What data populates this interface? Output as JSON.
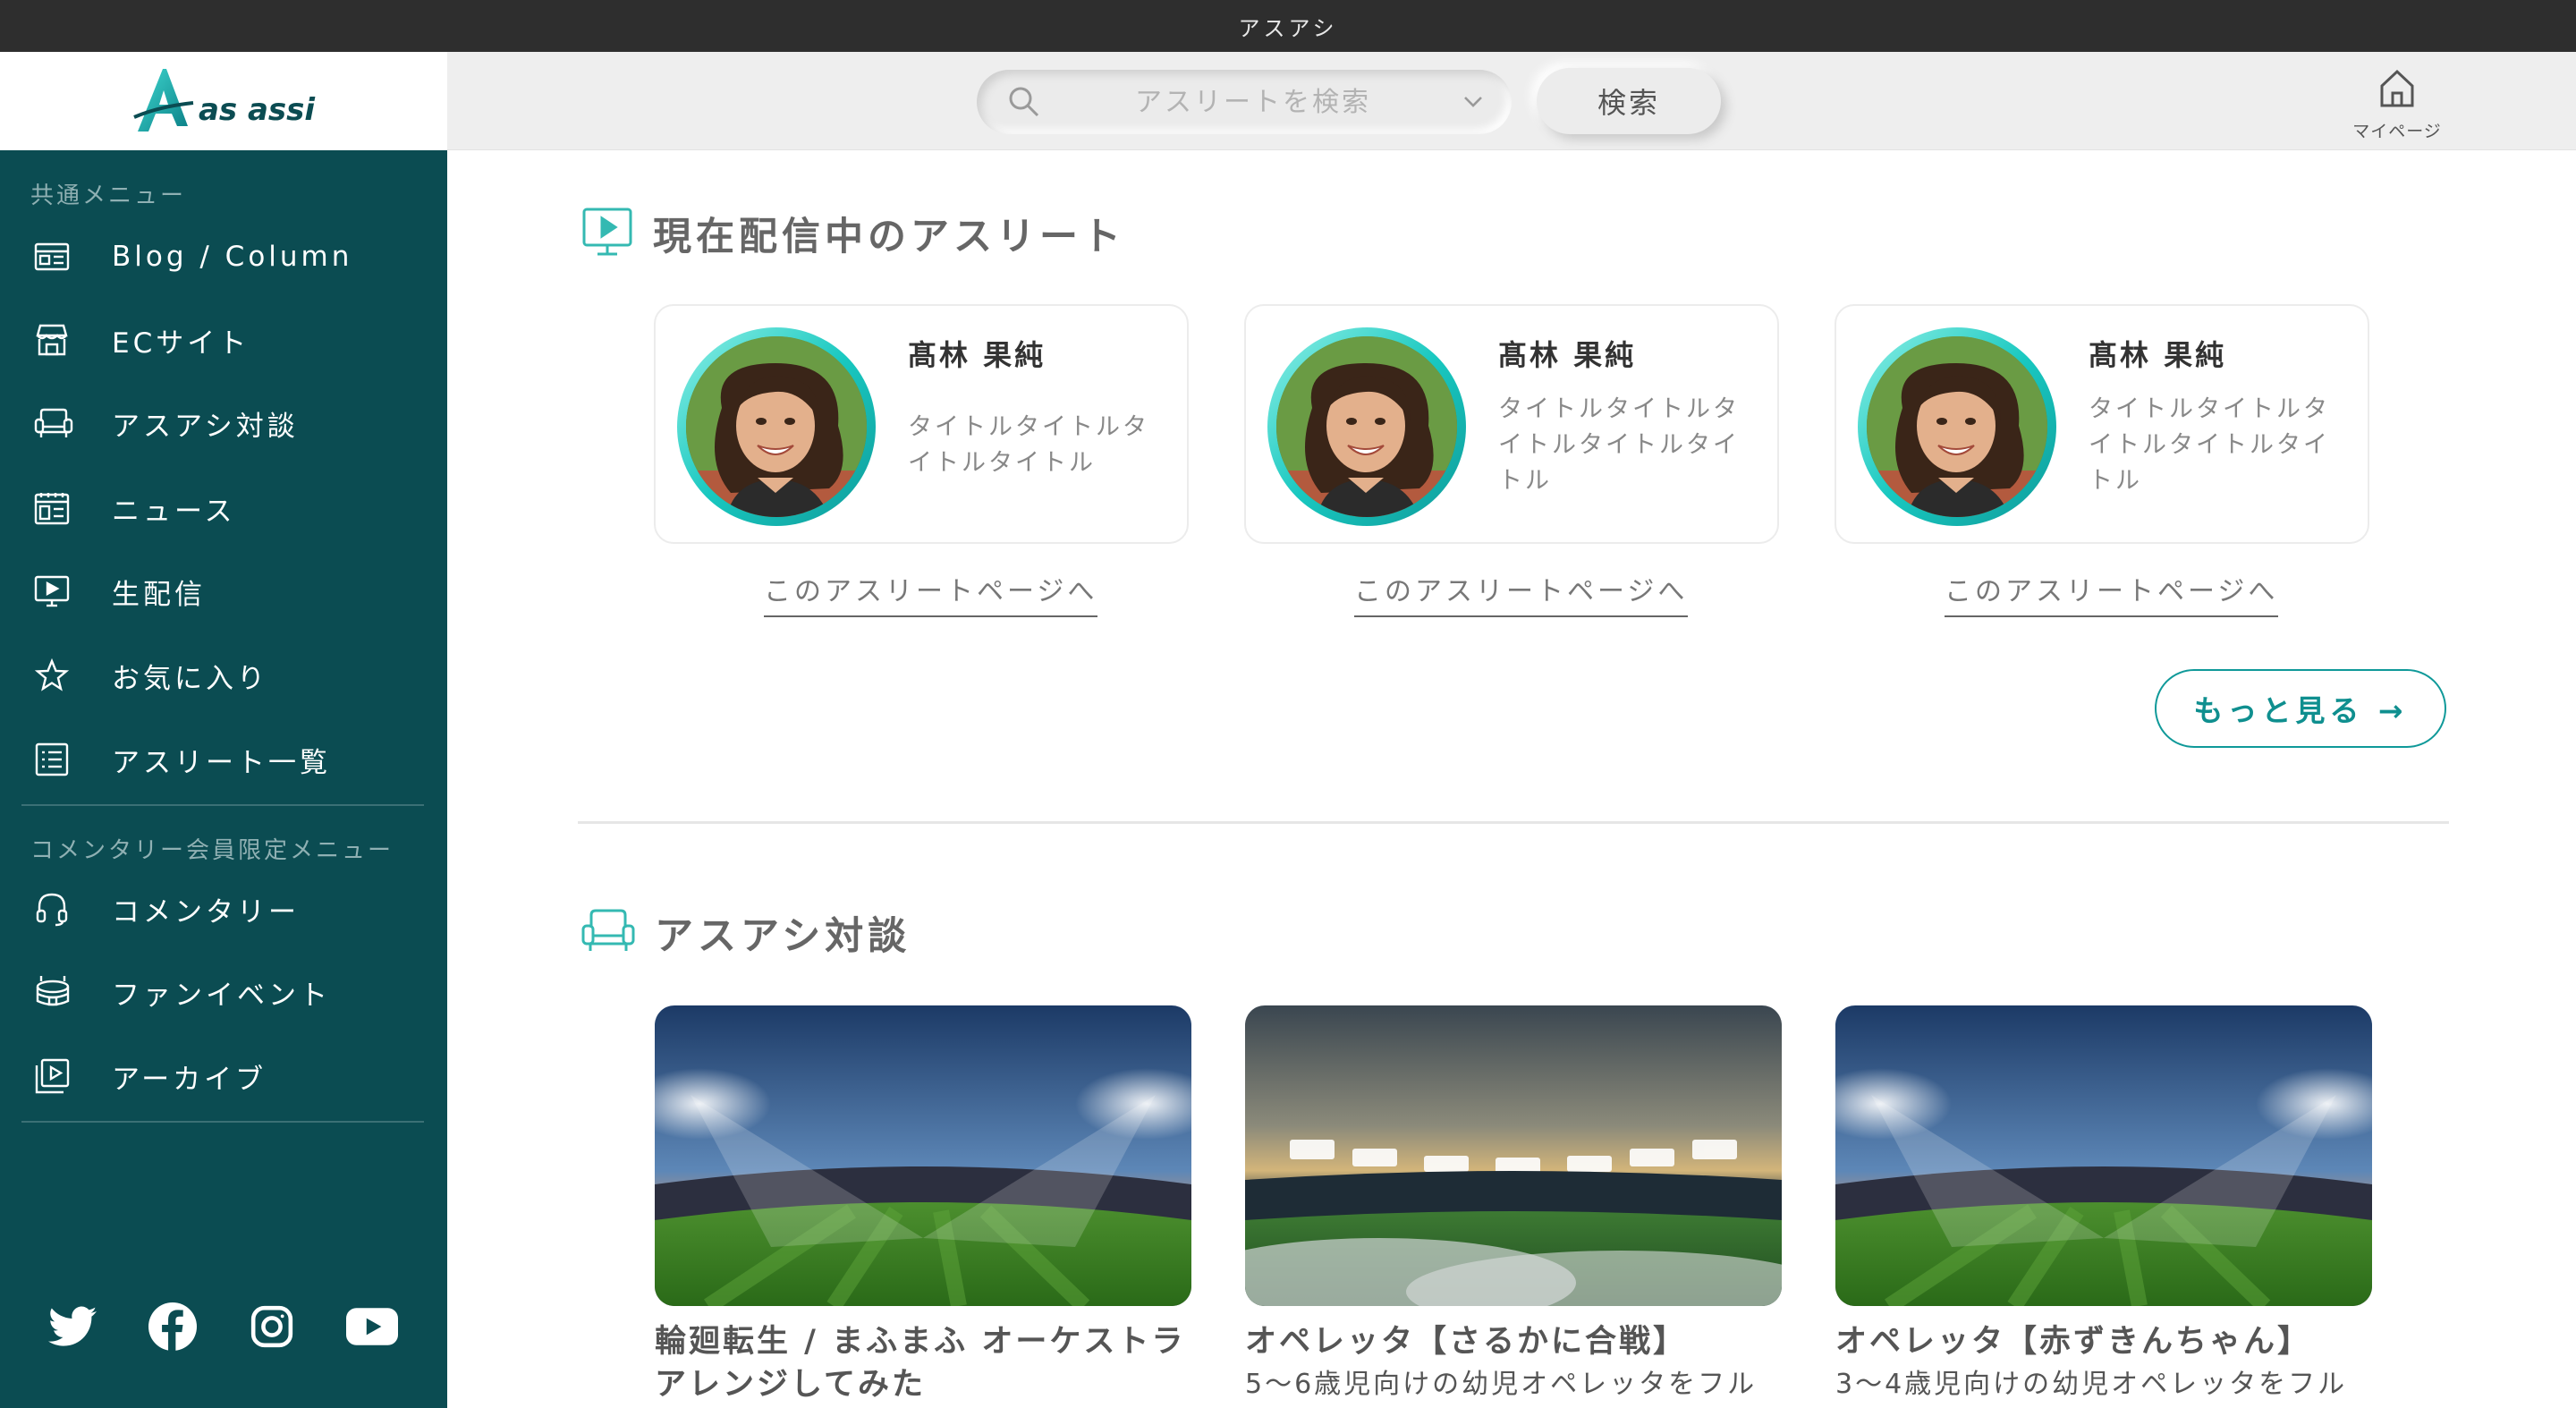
{
  "window": {
    "title": "アスアシ"
  },
  "brand": {
    "logo_text": "as assi"
  },
  "header": {
    "search_placeholder": "アスリートを検索",
    "search_button": "検索",
    "mypage_label": "マイページ"
  },
  "sidebar": {
    "common_label": "共通メニュー",
    "items": [
      {
        "label": "Blog / Column",
        "icon": "blog-icon"
      },
      {
        "label": "ECサイト",
        "icon": "shop-icon"
      },
      {
        "label": "アスアシ対談",
        "icon": "sofa-icon"
      },
      {
        "label": "ニュース",
        "icon": "news-icon"
      },
      {
        "label": "生配信",
        "icon": "play-screen-icon"
      },
      {
        "label": "お気に入り",
        "icon": "star-icon"
      },
      {
        "label": "アスリート一覧",
        "icon": "list-icon"
      }
    ],
    "member_label": "コメンタリー会員限定メニュー",
    "member_items": [
      {
        "label": "コメンタリー",
        "icon": "headset-icon"
      },
      {
        "label": "ファンイベント",
        "icon": "stadium-icon"
      },
      {
        "label": "アーカイブ",
        "icon": "archive-icon"
      }
    ],
    "social": [
      "twitter-icon",
      "facebook-icon",
      "instagram-icon",
      "youtube-icon"
    ]
  },
  "live": {
    "title": "現在配信中のアスリート",
    "cards": [
      {
        "name": "髙林 果純",
        "desc": "タイトルタイトルタイトルタイトル",
        "link": "このアスリートページへ"
      },
      {
        "name": "髙林 果純",
        "desc": "タイトルタイトルタイトルタイトルタイトル",
        "link": "このアスリートページへ"
      },
      {
        "name": "髙林 果純",
        "desc": "タイトルタイトルタイトルタイトルタイトル",
        "link": "このアスリートページへ"
      }
    ],
    "more_button": "もっと見る →"
  },
  "talk": {
    "title": "アスアシ対談",
    "cards": [
      {
        "title_line1": "輪廻転生 / まふまふ オーケストラ",
        "title_line2": "アレンジしてみた"
      },
      {
        "title_line1": "オペレッタ【さるかに合戦】",
        "title_line2": "5〜6歳児向けの幼児オペレッタをフル"
      },
      {
        "title_line1": "オペレッタ【赤ずきんちゃん】",
        "title_line2": "3〜4歳児向けの幼児オペレッタをフル"
      }
    ]
  },
  "colors": {
    "accent": "#0b4c52",
    "teal": "#0f9999",
    "header_bg": "#eeeeee"
  }
}
